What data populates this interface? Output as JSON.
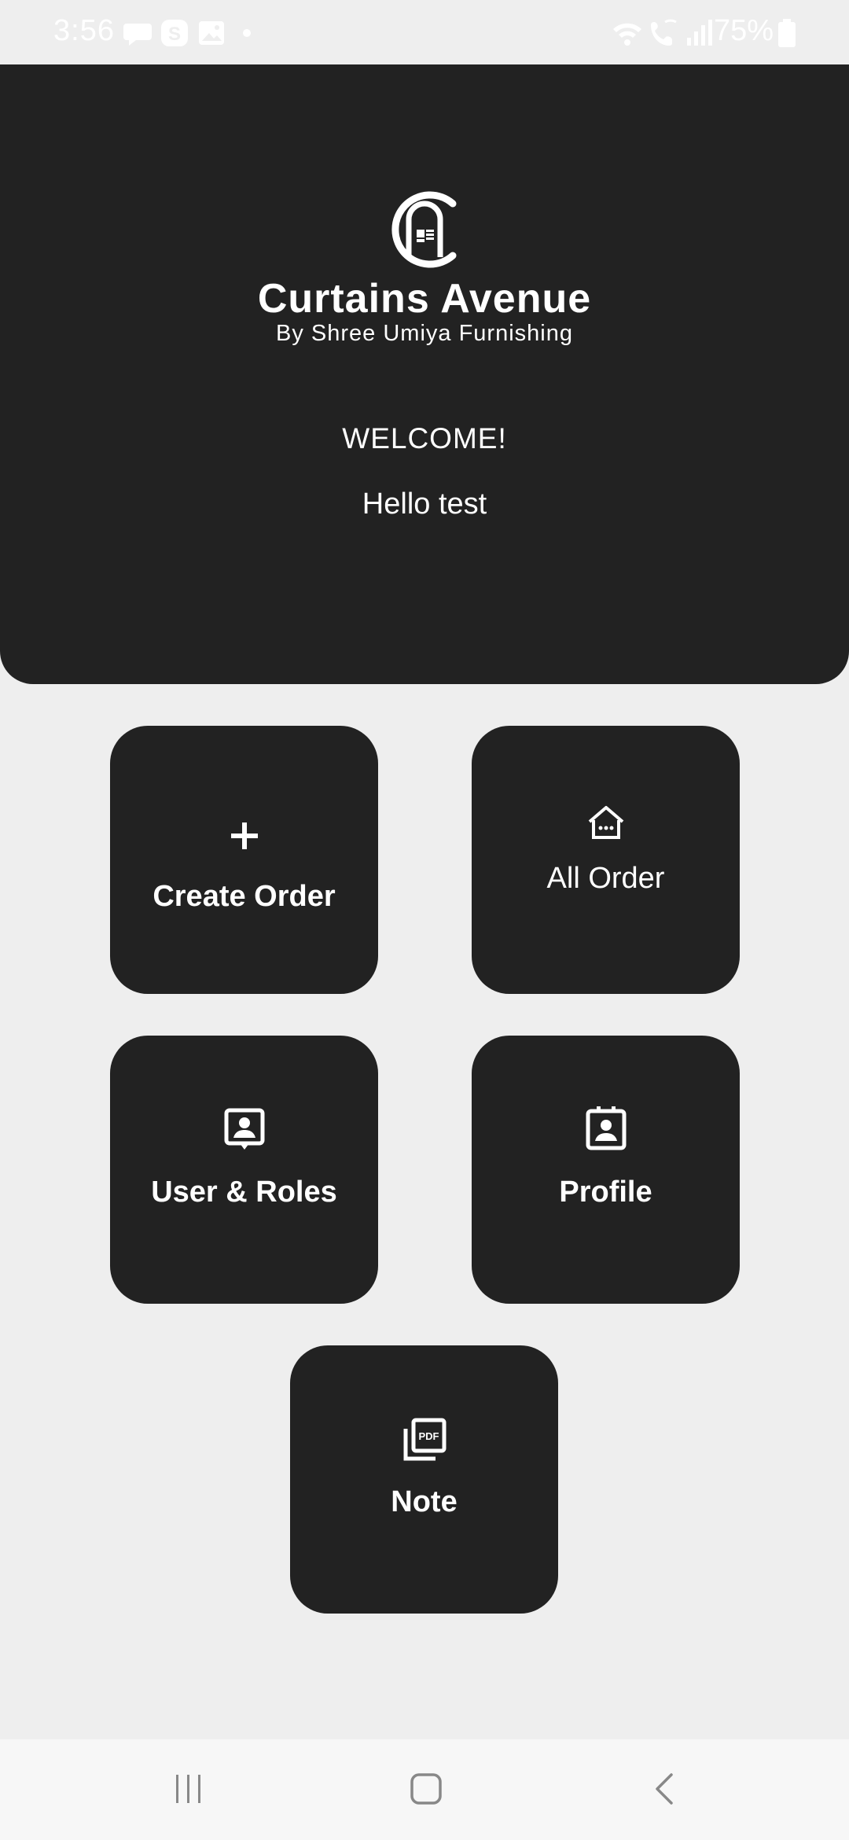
{
  "status_bar": {
    "time": "3:56",
    "battery": "75%",
    "icons": [
      "chat-icon",
      "skype-icon",
      "gallery-icon",
      "dot-icon",
      "wifi-icon",
      "wifi-call-icon",
      "signal-icon",
      "battery-icon"
    ]
  },
  "header": {
    "brand_name": "Curtains Avenue",
    "tagline": "By Shree Umiya Furnishing",
    "welcome": "WELCOME!",
    "greeting": "Hello test"
  },
  "tiles": [
    {
      "label": "Create Order",
      "icon": "plus-icon"
    },
    {
      "label": "All Order",
      "icon": "home-icon"
    },
    {
      "label": "User & Roles",
      "icon": "user-badge-icon"
    },
    {
      "label": "Profile",
      "icon": "profile-card-icon"
    },
    {
      "label": "Note",
      "icon": "pdf-icon"
    }
  ],
  "nav_bar": {
    "icons": [
      "recent-apps-icon",
      "home-button-icon",
      "back-icon"
    ]
  },
  "colors": {
    "background": "#eeeeee",
    "card": "#222222",
    "text_on_dark": "#ffffff"
  }
}
